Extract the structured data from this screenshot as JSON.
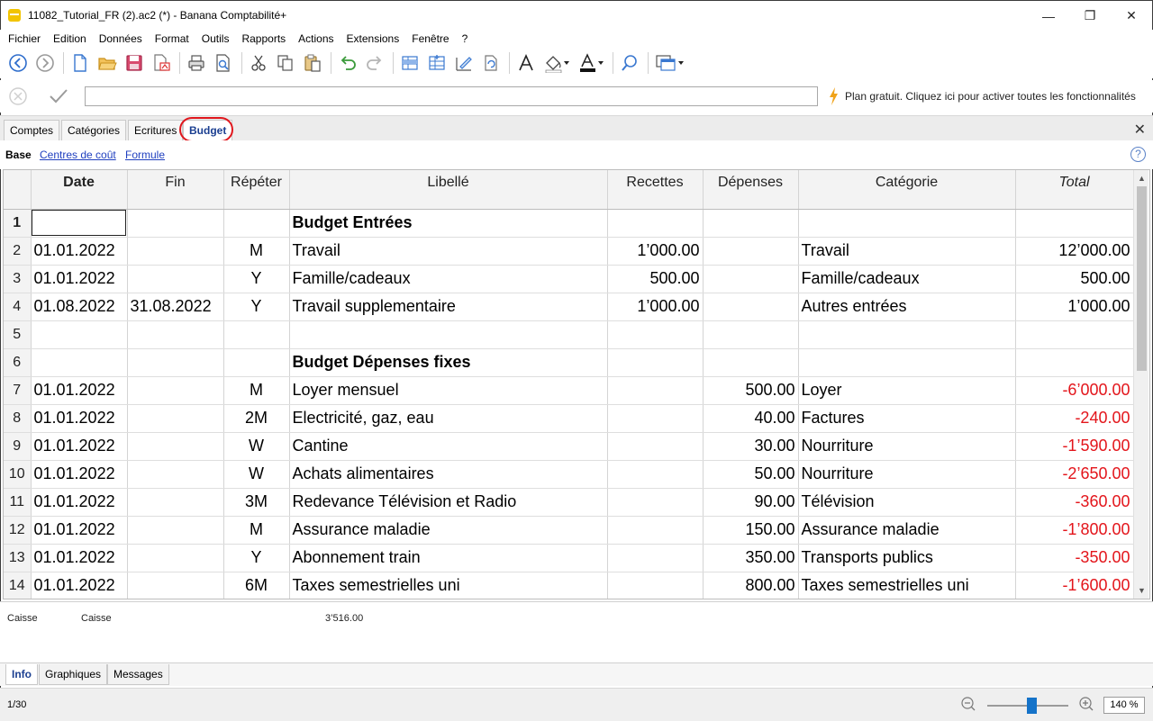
{
  "window": {
    "title": "11082_Tutorial_FR (2).ac2 (*) - Banana Comptabilité+",
    "minimize": "—",
    "restore": "❐",
    "close": "✕"
  },
  "menu": [
    "Fichier",
    "Edition",
    "Données",
    "Format",
    "Outils",
    "Rapports",
    "Actions",
    "Extensions",
    "Fenêtre",
    "?"
  ],
  "notice": {
    "text": "Plan gratuit. Cliquez ici pour activer toutes les fonctionnalités",
    "icon": "lightning-icon",
    "color": "#f0a31a"
  },
  "tabs": [
    "Comptes",
    "Catégories",
    "Ecritures",
    "Budget"
  ],
  "active_tab": "Budget",
  "views": [
    "Base",
    "Centres de coût",
    "Formule"
  ],
  "help": "?",
  "columns": [
    "Date",
    "Fin",
    "Répéter",
    "Libellé",
    "Recettes",
    "Dépenses",
    "Catégorie",
    "Total"
  ],
  "rows": [
    {
      "n": "1",
      "date": "",
      "fin": "",
      "rep": "",
      "lib": "Budget Entrées",
      "rec": "",
      "dep": "",
      "cat": "",
      "total": "",
      "heading": true
    },
    {
      "n": "2",
      "date": "01.01.2022",
      "fin": "",
      "rep": "M",
      "lib": "Travail",
      "rec": "1’000.00",
      "dep": "",
      "cat": "Travail",
      "total": "12’000.00"
    },
    {
      "n": "3",
      "date": "01.01.2022",
      "fin": "",
      "rep": "Y",
      "lib": "Famille/cadeaux",
      "rec": "500.00",
      "dep": "",
      "cat": "Famille/cadeaux",
      "total": "500.00"
    },
    {
      "n": "4",
      "date": "01.08.2022",
      "fin": "31.08.2022",
      "rep": "Y",
      "lib": "Travail supplementaire",
      "rec": "1’000.00",
      "dep": "",
      "cat": "Autres entrées",
      "total": "1’000.00"
    },
    {
      "n": "5",
      "date": "",
      "fin": "",
      "rep": "",
      "lib": "",
      "rec": "",
      "dep": "",
      "cat": "",
      "total": ""
    },
    {
      "n": "6",
      "date": "",
      "fin": "",
      "rep": "",
      "lib": "Budget Dépenses fixes",
      "rec": "",
      "dep": "",
      "cat": "",
      "total": "",
      "heading": true
    },
    {
      "n": "7",
      "date": "01.01.2022",
      "fin": "",
      "rep": "M",
      "lib": "Loyer mensuel",
      "rec": "",
      "dep": "500.00",
      "cat": "Loyer",
      "total": "-6’000.00",
      "negative": true
    },
    {
      "n": "8",
      "date": "01.01.2022",
      "fin": "",
      "rep": "2M",
      "lib": "Electricité, gaz, eau",
      "rec": "",
      "dep": "40.00",
      "cat": "Factures",
      "total": "-240.00",
      "negative": true
    },
    {
      "n": "9",
      "date": "01.01.2022",
      "fin": "",
      "rep": "W",
      "lib": "Cantine",
      "rec": "",
      "dep": "30.00",
      "cat": "Nourriture",
      "total": "-1’590.00",
      "negative": true
    },
    {
      "n": "10",
      "date": "01.01.2022",
      "fin": "",
      "rep": "W",
      "lib": "Achats alimentaires",
      "rec": "",
      "dep": "50.00",
      "cat": "Nourriture",
      "total": "-2’650.00",
      "negative": true
    },
    {
      "n": "11",
      "date": "01.01.2022",
      "fin": "",
      "rep": "3M",
      "lib": "Redevance Télévision et Radio",
      "rec": "",
      "dep": "90.00",
      "cat": "Télévision",
      "total": "-360.00",
      "negative": true
    },
    {
      "n": "12",
      "date": "01.01.2022",
      "fin": "",
      "rep": "M",
      "lib": "Assurance maladie",
      "rec": "",
      "dep": "150.00",
      "cat": "Assurance maladie",
      "total": "-1’800.00",
      "negative": true
    },
    {
      "n": "13",
      "date": "01.01.2022",
      "fin": "",
      "rep": "Y",
      "lib": "Abonnement train",
      "rec": "",
      "dep": "350.00",
      "cat": "Transports publics",
      "total": "-350.00",
      "negative": true
    },
    {
      "n": "14",
      "date": "01.01.2022",
      "fin": "",
      "rep": "6M",
      "lib": "Taxes semestrielles uni",
      "rec": "",
      "dep": "800.00",
      "cat": "Taxes semestrielles uni",
      "total": "-1’600.00",
      "negative": true
    }
  ],
  "info": {
    "account": "Caisse",
    "description": "Caisse",
    "amount": "3’516.00"
  },
  "bottom_tabs": [
    "Info",
    "Graphiques",
    "Messages"
  ],
  "status": {
    "record": "1/30",
    "zoom": "140 %"
  },
  "colors": {
    "negative": "#e3151b",
    "link": "#1f3fbf",
    "active_tab": "#1b3f91",
    "highlight_ring": "#e0171d"
  }
}
